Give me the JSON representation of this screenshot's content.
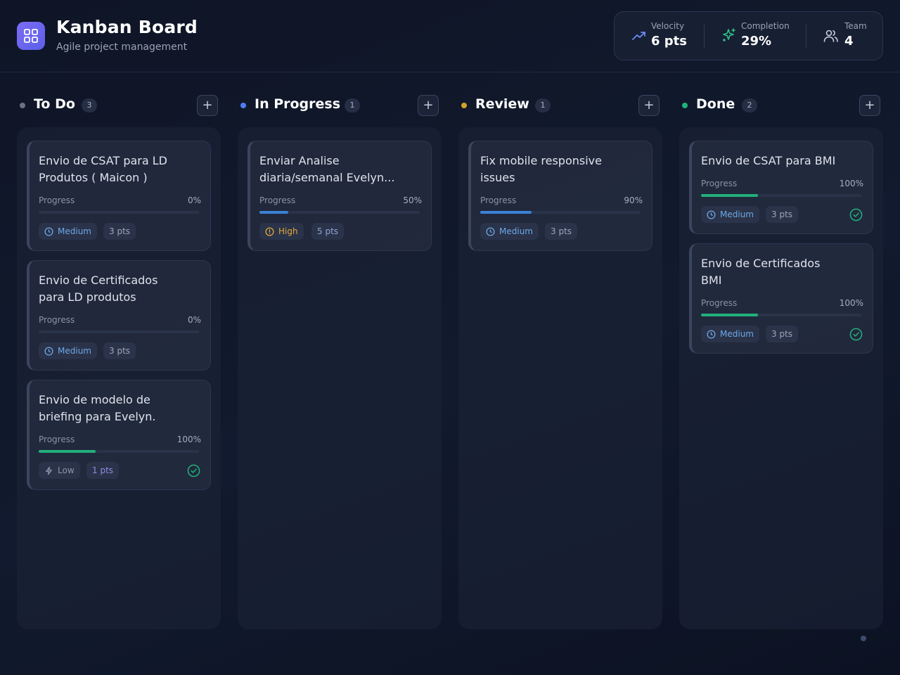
{
  "header": {
    "title": "Kanban Board",
    "subtitle": "Agile project management",
    "logo_icon": "grid-icon",
    "stats": [
      {
        "label": "Velocity",
        "value": "6 pts",
        "icon": "trending-up-icon",
        "color": "#6b8cf5"
      },
      {
        "label": "Completion",
        "value": "29%",
        "icon": "sparkle-icon",
        "color": "#2fbf85"
      },
      {
        "label": "Team",
        "value": "4",
        "icon": "users-icon",
        "color": "#c9cfdc"
      }
    ]
  },
  "columns": [
    {
      "title": "To Do",
      "count": "3",
      "dot_color": "#6b7280",
      "cards": [
        {
          "title_lines": [
            "Envio de CSAT para LD",
            "Produtos ( Maicon )"
          ],
          "progress_label": "Progress",
          "progress_text": "0%",
          "progress": 0,
          "priority": "Medium",
          "priority_icon": "clock-icon",
          "points": "3 pts",
          "done": false
        },
        {
          "title_lines": [
            "Envio de Certificados",
            "para LD produtos"
          ],
          "progress_label": "Progress",
          "progress_text": "0%",
          "progress": 0,
          "priority": "Medium",
          "priority_icon": "clock-icon",
          "points": "3 pts",
          "done": false
        },
        {
          "title_lines": [
            "Envio de modelo de",
            "briefing para Evelyn."
          ],
          "progress_label": "Progress",
          "progress_text": "100%",
          "progress": 100,
          "priority": "Low",
          "priority_icon": "bolt-icon",
          "points": "1 pts",
          "done": true
        }
      ]
    },
    {
      "title": "In Progress",
      "count": "1",
      "dot_color": "#4f7cf0",
      "cards": [
        {
          "title_lines": [
            "Enviar Analise",
            "diaria/semanal Evelyn..."
          ],
          "progress_label": "Progress",
          "progress_text": "50%",
          "progress": 50,
          "priority": "High",
          "priority_icon": "alert-circle-icon",
          "points": "5 pts",
          "done": false
        }
      ]
    },
    {
      "title": "Review",
      "count": "1",
      "dot_color": "#d4a02a",
      "cards": [
        {
          "title_lines": [
            "Fix mobile responsive",
            "issues"
          ],
          "progress_label": "Progress",
          "progress_text": "90%",
          "progress": 90,
          "priority": "Medium",
          "priority_icon": "clock-icon",
          "points": "3 pts",
          "done": false
        }
      ]
    },
    {
      "title": "Done",
      "count": "2",
      "dot_color": "#22b07a",
      "cards": [
        {
          "title_lines": [
            "Envio de CSAT para BMI"
          ],
          "progress_label": "Progress",
          "progress_text": "100%",
          "progress": 100,
          "priority": "Medium",
          "priority_icon": "clock-icon",
          "points": "3 pts",
          "done": true
        },
        {
          "title_lines": [
            "Envio de Certificados",
            "BMI"
          ],
          "progress_label": "Progress",
          "progress_text": "100%",
          "progress": 100,
          "priority": "Medium",
          "priority_icon": "clock-icon",
          "points": "3 pts",
          "done": true
        }
      ]
    }
  ],
  "colors": {
    "fill_blue": "#3b82d6",
    "fill_green": "#22b07a",
    "done_check": "#22b07a"
  }
}
